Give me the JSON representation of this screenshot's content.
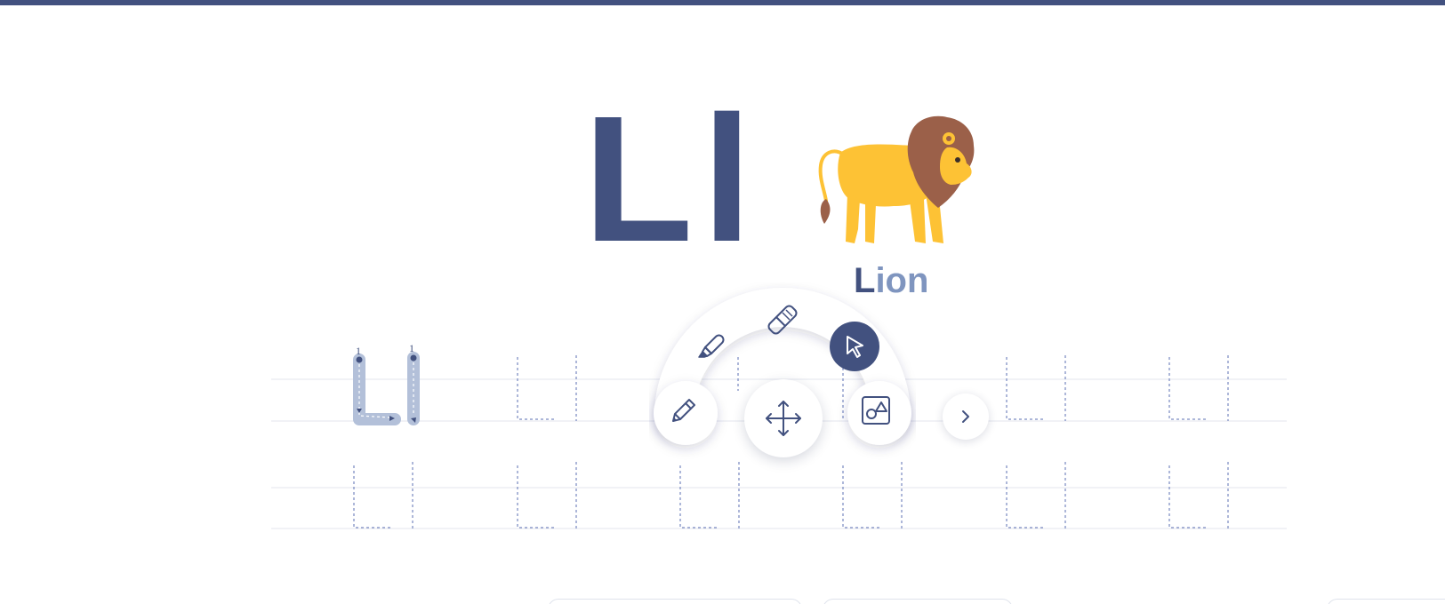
{
  "worksheet": {
    "letter": "Ll",
    "word": {
      "first": "L",
      "rest": "ion"
    },
    "image_icon": "lion-icon",
    "stroke_order_number": "1"
  },
  "toolbar": {
    "tools": [
      {
        "name": "pencil",
        "icon": "pencil-icon"
      },
      {
        "name": "marker",
        "icon": "marker-icon"
      },
      {
        "name": "eraser",
        "icon": "eraser-icon"
      },
      {
        "name": "pointer",
        "icon": "pointer-icon",
        "selected": true
      },
      {
        "name": "move",
        "icon": "move-icon"
      },
      {
        "name": "image",
        "icon": "image-icon"
      }
    ],
    "next_icon": "chevron-right-icon"
  },
  "colors": {
    "accent": "#42517f",
    "accent_light": "#7f95bf",
    "trace_fill": "#b3c0d9",
    "guide_line": "#e3e6ee",
    "dashed_letter": "#5b6fb3",
    "lion_body": "#fdc235",
    "lion_mane": "#9b6049"
  }
}
